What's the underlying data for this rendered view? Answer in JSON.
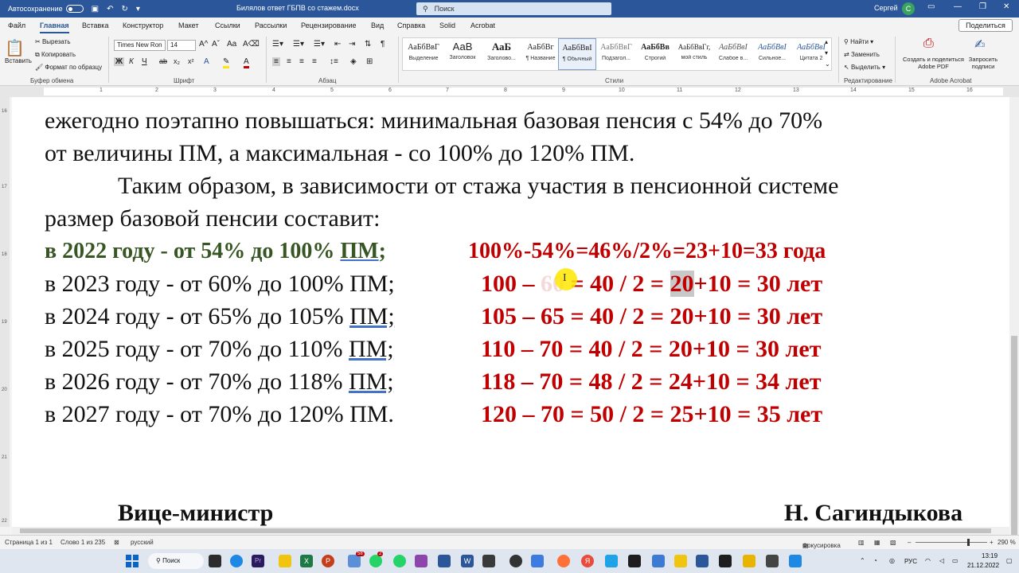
{
  "titlebar": {
    "autosave_label": "Автосохранение",
    "doc_title": "Билялов ответ ГБПВ со стажем.docx",
    "search_placeholder": "Поиск",
    "user_name": "Сергей",
    "user_initial": "С"
  },
  "tabs": [
    "Файл",
    "Главная",
    "Вставка",
    "Конструктор",
    "Макет",
    "Ссылки",
    "Рассылки",
    "Рецензирование",
    "Вид",
    "Справка",
    "Solid",
    "Acrobat"
  ],
  "active_tab": "Главная",
  "share_label": "Поделиться",
  "ribbon": {
    "clipboard": {
      "paste": "Вставить",
      "cut": "Вырезать",
      "copy": "Копировать",
      "format_painter": "Формат по образцу",
      "label": "Буфер обмена"
    },
    "font": {
      "name": "Times New Ron",
      "size": "14",
      "label": "Шрифт"
    },
    "paragraph": {
      "label": "Абзац"
    },
    "styles": {
      "label": "Стили",
      "items": [
        {
          "sample": "АаБбВвГ",
          "name": "Выделение"
        },
        {
          "sample": "АаВ",
          "name": "Заголовок"
        },
        {
          "sample": "АаБ",
          "name": "Заголово..."
        },
        {
          "sample": "АаБбВг",
          "name": "¶ Название"
        },
        {
          "sample": "АаБбВвI",
          "name": "¶ Обычный"
        },
        {
          "sample": "АаБбВвГ",
          "name": "Подзагол..."
        },
        {
          "sample": "АаБбВв",
          "name": "Строгий"
        },
        {
          "sample": "АаБбВвГг,",
          "name": "мой стиль"
        },
        {
          "sample": "АаБбВвI",
          "name": "Слабое в..."
        },
        {
          "sample": "АаБбВвI",
          "name": "Сильное..."
        },
        {
          "sample": "АаБбВвI",
          "name": "Цитата 2"
        }
      ]
    },
    "editing": {
      "find": "Найти",
      "replace": "Заменить",
      "select": "Выделить",
      "label": "Редактирование"
    },
    "acrobat": {
      "create": "Создать и поделиться Adobe PDF",
      "request": "Запросить подписи",
      "label": "Adobe Acrobat"
    }
  },
  "document": {
    "line1": "ежегодно поэтапно повышаться: минимальная базовая пенсия с 54% до 70%",
    "line2": "от величины ПМ, а максимальная - со 100% до 120% ПМ.",
    "line3": "Таким образом, в зависимости от стажа участия в пенсионной системе",
    "line4": "размер базовой пенсии составит:",
    "rows": [
      {
        "left_a": "в 2022 году - от 54% до 100% ",
        "left_pm": "ПМ",
        "left_b": ";",
        "calc": "100%-54%=46%/2%=23+10=33 года"
      },
      {
        "left_a": "в 2023 году - от 60% до 100% ПМ;",
        "calc_a": "100 – ",
        "calc_hidden": "60",
        "calc_b": " = 40 / 2 = ",
        "calc_hl": "20",
        "calc_c": "+10 = 30 лет"
      },
      {
        "left_a": "в 2024 году - от 65% до 105% ",
        "left_pm": "ПМ;",
        "calc": "105 – 65 = 40 / 2 = 20+10 = 30 лет"
      },
      {
        "left_a": "в 2025 году - от 70% до 110% ",
        "left_pm": "ПМ;",
        "calc": "110 – 70 = 40 / 2 = 20+10 = 30 лет"
      },
      {
        "left_a": "в 2026 году - от 70% до 118% ",
        "left_pm": "ПМ;",
        "calc": "118 – 70 = 48 / 2 = 24+10 = 34 лет"
      },
      {
        "left_a": "в 2027 году - от 70% до 120% ПМ.",
        "calc": "120 – 70 = 50 / 2 = 25+10 = 35 лет"
      }
    ],
    "signature_title": "Вице-министр",
    "signature_name": "Н. Сагиндыкова"
  },
  "statusbar": {
    "page": "Страница 1 из 1",
    "words": "Слово 1 из 235",
    "language": "русский",
    "focus": "Фокусировка",
    "zoom": "290 %"
  },
  "taskbar": {
    "search": "Поиск",
    "lang": "РУС",
    "time": "13:19",
    "date": "21.12.2022",
    "badge1": "58",
    "badge2": "2"
  },
  "colors": {
    "accent": "#2b579a",
    "green_text": "#375623",
    "red_text": "#c00000"
  }
}
